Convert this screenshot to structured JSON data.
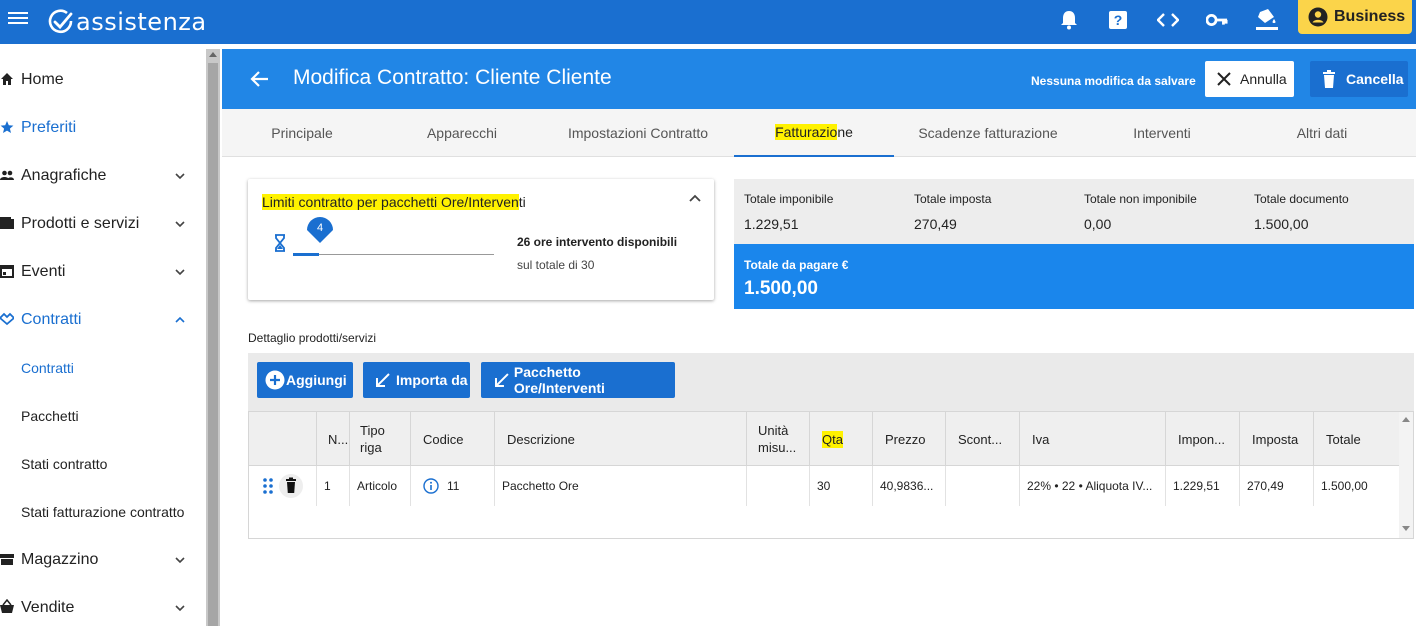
{
  "topbar": {
    "app_name": "assistenza",
    "icons": [
      "menu-icon",
      "bell-icon",
      "help-icon",
      "code-icon",
      "key-icon",
      "paint-bucket-icon"
    ],
    "business_label": "Business",
    "brand_color": "#1a6fd0",
    "accent_color": "#fbd44a"
  },
  "sidebar": {
    "home": "Home",
    "preferiti": "Preferiti",
    "anagrafiche": "Anagrafiche",
    "prodotti": "Prodotti e servizi",
    "eventi": "Eventi",
    "contratti": "Contratti",
    "sub": {
      "contratti": "Contratti",
      "pacchetti": "Pacchetti",
      "stati_contratto": "Stati contratto",
      "stati_fatturazione": "Stati fatturazione contratto"
    },
    "magazzino": "Magazzino",
    "vendite": "Vendite"
  },
  "header": {
    "title": "Modifica Contratto: Cliente Cliente",
    "status": "Nessuna modifica da salvare",
    "annulla": "Annulla",
    "cancella": "Cancella"
  },
  "tabs": {
    "principale": "Principale",
    "apparecchi": "Apparecchi",
    "impostazioni": "Impostazioni Contratto",
    "fatturazione_hl": "Fatturazio",
    "fatturazione_rest": "ne",
    "scadenze": "Scadenze fatturazione",
    "interventi": "Interventi",
    "altri": "Altri dati"
  },
  "limiti": {
    "title_hl": "Limiti contratto per pacchetti Ore/Interven",
    "title_rest": "ti",
    "slider_value": "4",
    "slider_fraction": 0.13,
    "available": "26 ore intervento disponibili",
    "total": "sul totale di 30"
  },
  "totals": {
    "imponibile_label": "Totale imponibile",
    "imponibile_value": "1.229,51",
    "imposta_label": "Totale imposta",
    "imposta_value": "270,49",
    "non_imponibile_label": "Totale non imponibile",
    "non_imponibile_value": "0,00",
    "documento_label": "Totale documento",
    "documento_value": "1.500,00",
    "pagare_label": "Totale da pagare €",
    "pagare_value": "1.500,00"
  },
  "detail": {
    "label": "Dettaglio prodotti/servizi",
    "btn_aggiungi": "Aggiungi",
    "btn_importa": "Importa da",
    "btn_pacchetto": "Pacchetto Ore/Interventi"
  },
  "grid": {
    "headers": {
      "n": "N...",
      "tipo": [
        "Tipo",
        "riga"
      ],
      "codice": "Codice",
      "descrizione": "Descrizione",
      "unita": [
        "Unità",
        "misu..."
      ],
      "qta": "Qta",
      "prezzo": "Prezzo",
      "sconto": "Scont...",
      "iva": "Iva",
      "imponibile": "Impon...",
      "imposta": "Imposta",
      "totale": "Totale"
    },
    "row": {
      "n": "1",
      "tipo": "Articolo",
      "codice": "11",
      "descrizione": "Pacchetto Ore",
      "unita": "",
      "qta": "30",
      "prezzo": "40,9836...",
      "sconto": "",
      "iva": "22% • 22 • Aliquota IV...",
      "imponibile": "1.229,51",
      "imposta": "270,49",
      "totale": "1.500,00"
    }
  }
}
